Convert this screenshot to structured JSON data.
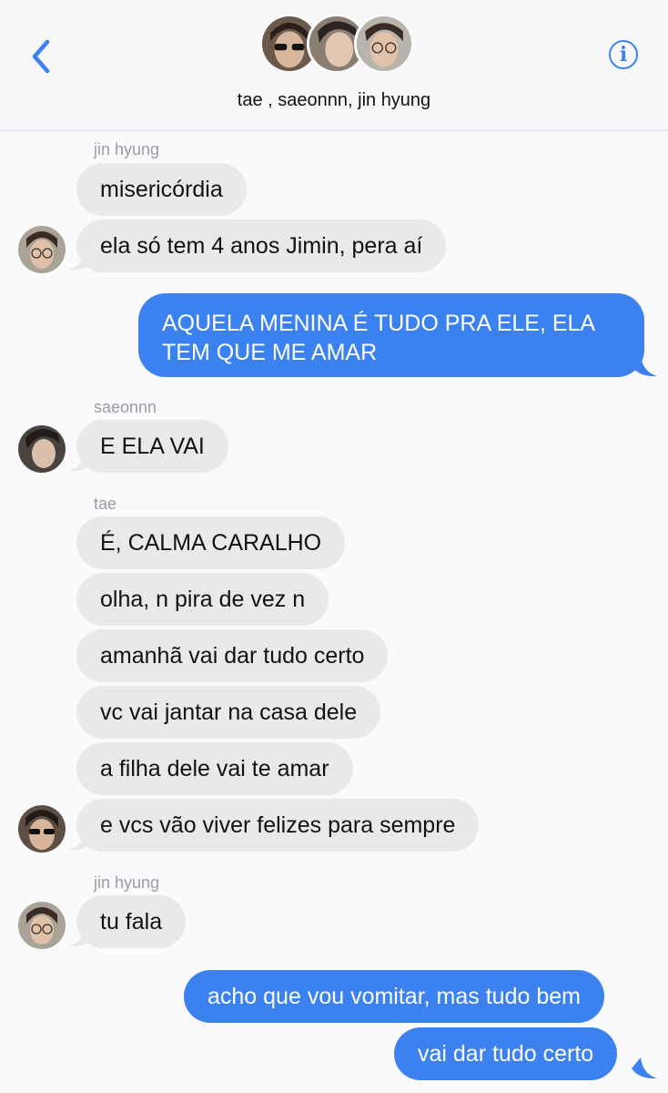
{
  "header": {
    "group_names": "tae , saeonnn, jin hyung",
    "back_icon": "chevron-left-icon",
    "info_icon": "info-icon",
    "info_glyph": "i",
    "accent": "#3b82f0"
  },
  "messages": [
    {
      "sender": "jin hyung",
      "text": "misericórdia"
    },
    {
      "text": "ela só tem 4 anos Jimin, pera aí"
    },
    {
      "text_line1": "AQUELA MENINA É TUDO PRA ELE, ELA",
      "text_line2": "TEM QUE ME AMAR"
    },
    {
      "sender": "saeonnn",
      "text": "E ELA VAI"
    },
    {
      "sender": "tae",
      "text": "É, CALMA CARALHO"
    },
    {
      "text": "olha, n pira de vez n"
    },
    {
      "text": "amanhã vai dar tudo certo"
    },
    {
      "text": "vc vai jantar na casa dele"
    },
    {
      "text": "a filha dele vai te amar"
    },
    {
      "text": "e vcs vão viver felizes para sempre"
    },
    {
      "sender": "jin hyung",
      "text": "tu fala"
    },
    {
      "text": "acho que vou vomitar, mas tudo bem"
    },
    {
      "text": "vai dar tudo certo"
    }
  ],
  "colors": {
    "incoming_bubble": "#e9e9eb",
    "outgoing_bubble": "#3b82f0",
    "sender_label": "#9b9ba1"
  }
}
